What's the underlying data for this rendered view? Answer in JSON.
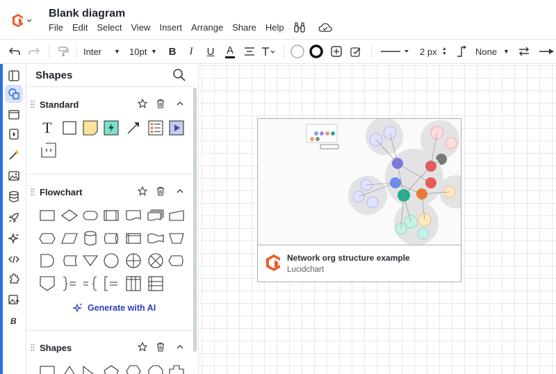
{
  "app": {
    "document_title": "Blank diagram",
    "menu": [
      "File",
      "Edit",
      "Select",
      "View",
      "Insert",
      "Arrange",
      "Share",
      "Help"
    ]
  },
  "toolbar": {
    "font_family": "Inter",
    "font_size": "10pt",
    "bold": "B",
    "italic": "I",
    "underline": "U",
    "text_color": "A",
    "line_width": "2 px",
    "arrow_end": "None"
  },
  "panel": {
    "title": "Shapes",
    "sections": [
      {
        "name": "Standard"
      },
      {
        "name": "Flowchart"
      },
      {
        "name": "Shapes"
      }
    ],
    "standard_text_shape": "T",
    "generate_ai_label": "Generate with AI"
  },
  "rail": {
    "items": [
      "layers-icon",
      "shapes-icon",
      "frame-icon",
      "fill-icon",
      "magic-icon",
      "image-icon",
      "database-icon",
      "rocket-icon",
      "sparkle-icon",
      "code-icon",
      "puzzle-icon",
      "ai-image-icon",
      "brand-icon"
    ]
  },
  "canvas": {
    "template_card": {
      "title": "Network org structure example",
      "subtitle": "Lucidchart"
    }
  },
  "colors": {
    "accent": "#2e6fe0",
    "brand_orange": "#f05a28",
    "ai_blue": "#2c3db8"
  }
}
